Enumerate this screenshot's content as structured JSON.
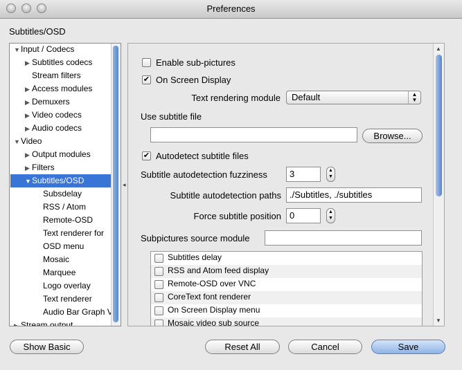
{
  "window": {
    "title": "Preferences"
  },
  "section_title": "Subtitles/OSD",
  "tree": {
    "items": [
      {
        "label": "Input / Codecs",
        "expander": "▼",
        "level": 0
      },
      {
        "label": "Subtitles codecs",
        "expander": "▶",
        "level": 1
      },
      {
        "label": "Stream filters",
        "expander": "",
        "level": 1
      },
      {
        "label": "Access modules",
        "expander": "▶",
        "level": 1
      },
      {
        "label": "Demuxers",
        "expander": "▶",
        "level": 1
      },
      {
        "label": "Video codecs",
        "expander": "▶",
        "level": 1
      },
      {
        "label": "Audio codecs",
        "expander": "▶",
        "level": 1
      },
      {
        "label": "Video",
        "expander": "▼",
        "level": 0
      },
      {
        "label": "Output modules",
        "expander": "▶",
        "level": 1
      },
      {
        "label": "Filters",
        "expander": "▶",
        "level": 1
      },
      {
        "label": "Subtitles/OSD",
        "expander": "▼",
        "level": 1,
        "selected": true
      },
      {
        "label": "Subsdelay",
        "expander": "",
        "level": 2
      },
      {
        "label": "RSS / Atom",
        "expander": "",
        "level": 2
      },
      {
        "label": "Remote-OSD",
        "expander": "",
        "level": 2
      },
      {
        "label": "Text renderer for",
        "expander": "",
        "level": 2
      },
      {
        "label": "OSD menu",
        "expander": "",
        "level": 2
      },
      {
        "label": "Mosaic",
        "expander": "",
        "level": 2
      },
      {
        "label": "Marquee",
        "expander": "",
        "level": 2
      },
      {
        "label": "Logo overlay",
        "expander": "",
        "level": 2
      },
      {
        "label": "Text renderer",
        "expander": "",
        "level": 2
      },
      {
        "label": "Audio Bar Graph V",
        "expander": "",
        "level": 2
      },
      {
        "label": "Stream output",
        "expander": "▶",
        "level": 0
      }
    ]
  },
  "settings": {
    "enable_subpictures": {
      "label": "Enable sub-pictures",
      "checked": false
    },
    "on_screen_display": {
      "label": "On Screen Display",
      "checked": true
    },
    "text_rendering_module": {
      "label": "Text rendering module",
      "value": "Default"
    },
    "use_subtitle_file": {
      "label": "Use subtitle file",
      "value": "",
      "browse_label": "Browse..."
    },
    "autodetect": {
      "label": "Autodetect subtitle files",
      "checked": true
    },
    "fuzziness": {
      "label": "Subtitle autodetection fuzziness",
      "value": "3"
    },
    "paths": {
      "label": "Subtitle autodetection paths",
      "value": "./Subtitles, ./subtitles"
    },
    "force_position": {
      "label": "Force subtitle position",
      "value": "0"
    },
    "subpictures_source": {
      "label": "Subpictures source module",
      "value": ""
    },
    "modules": [
      {
        "label": "Subtitles delay",
        "checked": false
      },
      {
        "label": "RSS and Atom feed display",
        "checked": false
      },
      {
        "label": "Remote-OSD over VNC",
        "checked": false
      },
      {
        "label": "CoreText font renderer",
        "checked": false
      },
      {
        "label": "On Screen Display menu",
        "checked": false
      },
      {
        "label": "Mosaic video sub source",
        "checked": false
      }
    ]
  },
  "buttons": {
    "show_basic": "Show Basic",
    "reset_all": "Reset All",
    "cancel": "Cancel",
    "save": "Save"
  },
  "colors": {
    "selection": "#3875d7",
    "default_button": "#8fb4e6"
  }
}
